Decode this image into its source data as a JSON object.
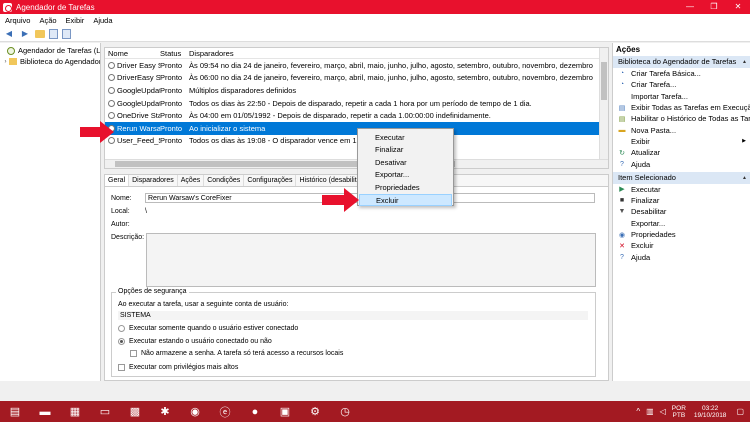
{
  "window": {
    "title": "Agendador de Tarefas",
    "controls": [
      "—",
      "❐",
      "✕"
    ]
  },
  "menu": [
    "Arquivo",
    "Ação",
    "Exibir",
    "Ajuda"
  ],
  "tree": [
    {
      "label": "Agendador de Tarefas (Local)"
    },
    {
      "label": "Biblioteca do Agendador de Tarefas"
    }
  ],
  "tasklist": {
    "columns": [
      "Nome",
      "Status",
      "Disparadores"
    ],
    "rows": [
      {
        "name": "Driver Easy Scheduled Scan",
        "status": "Pronto",
        "trigger": "Às 09:54 no dia 24 de janeiro, fevereiro, março, abril, maio, junho, julho, agosto, setembro, outubro, novembro, dezembro"
      },
      {
        "name": "DriverEasy Scheduled Scan",
        "status": "Pronto",
        "trigger": "Às 06:00 no dia 24 de janeiro, fevereiro, março, abril, maio, junho, julho, agosto, setembro, outubro, novembro, dezembro"
      },
      {
        "name": "GoogleUpdateTaskMachineCore",
        "status": "Pronto",
        "trigger": "Múltiplos disparadores definidos"
      },
      {
        "name": "GoogleUpdateTaskMachineUA",
        "status": "Pronto",
        "trigger": "Todos os dias às 22:50 - Depois de disparado, repetir a cada 1 hora por um período de tempo de 1 dia."
      },
      {
        "name": "OneDrive Standalone Update Task",
        "status": "Pronto",
        "trigger": "Às 04:00 em 01/05/1992 - Depois de disparado, repetir a cada 1.00:00:00 indefinidamente."
      },
      {
        "name": "Rerun Warsaw's CoreFixer",
        "status": "Pronto",
        "trigger": "Ao inicializar o sistema"
      },
      {
        "name": "User_Feed_Synchronization",
        "status": "Pronto",
        "trigger": "Todos os dias às 19:08 - O disparador vence em 19/10/2028"
      }
    ],
    "selected_index": 5
  },
  "details": {
    "tabs": [
      "Geral",
      "Disparadores",
      "Ações",
      "Condições",
      "Configurações",
      "Histórico (desabilitado)"
    ],
    "name_label": "Nome:",
    "name_value": "Rerun Warsaw's CoreFixer",
    "local_label": "Local:",
    "local_value": "\\",
    "author_label": "Autor:",
    "desc_label": "Descrição:",
    "security": {
      "legend": "Opções de segurança",
      "run_as_label": "Ao executar a tarefa, usar a seguinte conta de usuário:",
      "account": "SISTEMA",
      "opt_logged_on": "Executar somente quando o usuário estiver conectado",
      "opt_whether": "Executar estando o usuário conectado ou não",
      "no_store_pwd": "Não armazene a senha. A tarefa só terá acesso a recursos locais",
      "highest_priv": "Executar com privilégios mais altos"
    }
  },
  "context_menu": {
    "items": [
      "Executar",
      "Finalizar",
      "Desativar",
      "Exportar...",
      "Propriedades",
      "Excluir"
    ],
    "highlighted": "Excluir"
  },
  "actions": {
    "header": "Ações",
    "section1": "Biblioteca do Agendador de Tarefas",
    "items1": [
      {
        "label": "Criar Tarefa Básica...",
        "icon": "create-basic-task-icon"
      },
      {
        "label": "Criar Tarefa...",
        "icon": "create-task-icon"
      },
      {
        "label": "Importar Tarefa...",
        "icon": ""
      },
      {
        "label": "Exibir Todas as Tarefas em Execução",
        "icon": "running-tasks-icon"
      },
      {
        "label": "Habilitar o Histórico de Todas as Tarefas",
        "icon": "history-icon"
      },
      {
        "label": "Nova Pasta...",
        "icon": "new-folder-icon"
      },
      {
        "label": "Exibir",
        "icon": ""
      },
      {
        "label": "Atualizar",
        "icon": "refresh-icon"
      },
      {
        "label": "Ajuda",
        "icon": "help-icon"
      }
    ],
    "section2": "Item Selecionado",
    "items2": [
      {
        "label": "Executar",
        "icon": "run-icon"
      },
      {
        "label": "Finalizar",
        "icon": "end-icon"
      },
      {
        "label": "Desabilitar",
        "icon": "disable-icon"
      },
      {
        "label": "Exportar...",
        "icon": ""
      },
      {
        "label": "Propriedades",
        "icon": "properties-icon"
      },
      {
        "label": "Excluir",
        "icon": "delete-icon"
      },
      {
        "label": "Ajuda",
        "icon": "help-icon"
      }
    ]
  },
  "taskbar": {
    "lang_top": "POR",
    "lang_bottom": "PTB",
    "time": "03:22",
    "date": "19/10/2018"
  },
  "colors": {
    "titlebar": "#e8112d",
    "selection": "#0078d7",
    "taskbar": "#a31a22",
    "arrow": "#e8112d"
  }
}
